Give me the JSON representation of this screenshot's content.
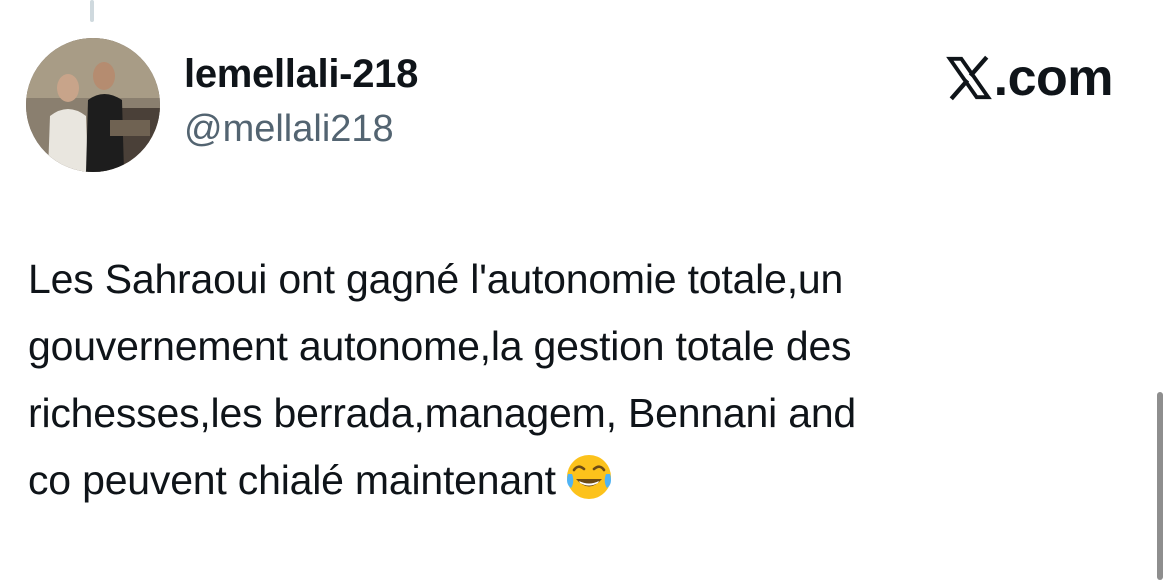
{
  "author": {
    "display_name": "lemellali-218",
    "handle": "@mellali218"
  },
  "brand": {
    "text": ".com",
    "icon": "x-logo-icon"
  },
  "tweet": {
    "lines": [
      "Les Sahraoui ont gagné l'autonomie totale,un",
      "gouvernement autonome,la gestion totale des",
      "richesses,les berrada,managem, Bennani and",
      "co peuvent chialé maintenant"
    ],
    "emoji": "face-with-tears-of-joy-icon"
  },
  "colors": {
    "text": "#0f1419",
    "secondary": "#536471",
    "thread_line": "#cfd9de"
  }
}
